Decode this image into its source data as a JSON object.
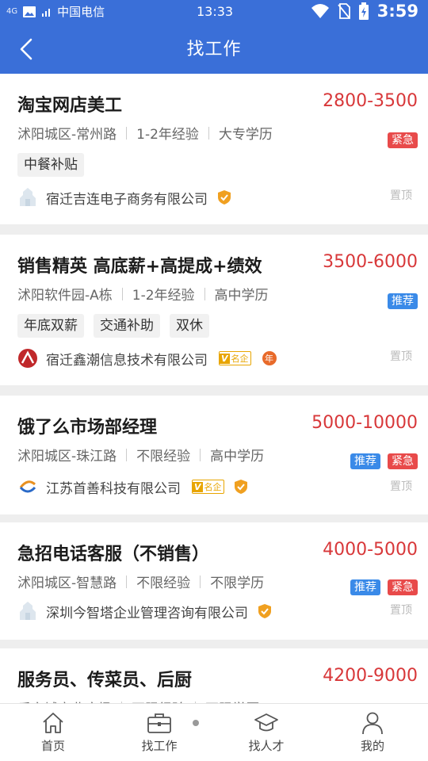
{
  "status_bar": {
    "signal_text": "4G",
    "carrier": "中国电信",
    "time_center": "13:33",
    "time_right": "3:59"
  },
  "navbar": {
    "title": "找工作"
  },
  "jobs": [
    {
      "title": "淘宝网店美工",
      "salary": "2800-3500",
      "location": "沭阳城区-常州路",
      "experience": "1-2年经验",
      "education": "大专学历",
      "badges": [
        "紧急"
      ],
      "tags": [
        "中餐补贴"
      ],
      "company": "宿迁吉连电子商务有限公司",
      "top_label": "置顶"
    },
    {
      "title": "销售精英 高底薪+高提成+绩效",
      "salary": "3500-6000",
      "location": "沭阳软件园-A栋",
      "experience": "1-2年经验",
      "education": "高中学历",
      "badges": [
        "推荐"
      ],
      "tags": [
        "年底双薪",
        "交通补助",
        "双休"
      ],
      "company": "宿迁鑫潮信息技术有限公司",
      "vip_label": "名企",
      "year_label": "年",
      "top_label": "置顶"
    },
    {
      "title": "饿了么市场部经理",
      "salary": "5000-10000",
      "location": "沭阳城区-珠江路",
      "experience": "不限经验",
      "education": "高中学历",
      "badges": [
        "推荐",
        "紧急"
      ],
      "company": "江苏首善科技有限公司",
      "vip_label": "名企",
      "top_label": "置顶"
    },
    {
      "title": "急招电话客服（不销售）",
      "salary": "4000-5000",
      "location": "沭阳城区-智慧路",
      "experience": "不限经验",
      "education": "不限学历",
      "badges": [
        "推荐",
        "紧急"
      ],
      "company": "深圳今智塔企业管理咨询有限公司",
      "top_label": "置顶"
    },
    {
      "title": "服务员、传菜员、后厨",
      "salary": "4200-9000",
      "location": "乐之城商业广场",
      "experience": "不限经验",
      "education": "不限学历"
    }
  ],
  "tabbar": {
    "items": [
      {
        "label": "首页",
        "icon": "home-icon"
      },
      {
        "label": "找工作",
        "icon": "briefcase-icon"
      },
      {
        "label": "找人才",
        "icon": "graduation-cap-icon"
      },
      {
        "label": "我的",
        "icon": "person-icon"
      }
    ]
  },
  "colors": {
    "header": "#3a6fd8",
    "salary": "#d8383a",
    "badge_urgent": "#e84a4a",
    "badge_recommend": "#3a8ae8",
    "verified": "#f0a020"
  }
}
